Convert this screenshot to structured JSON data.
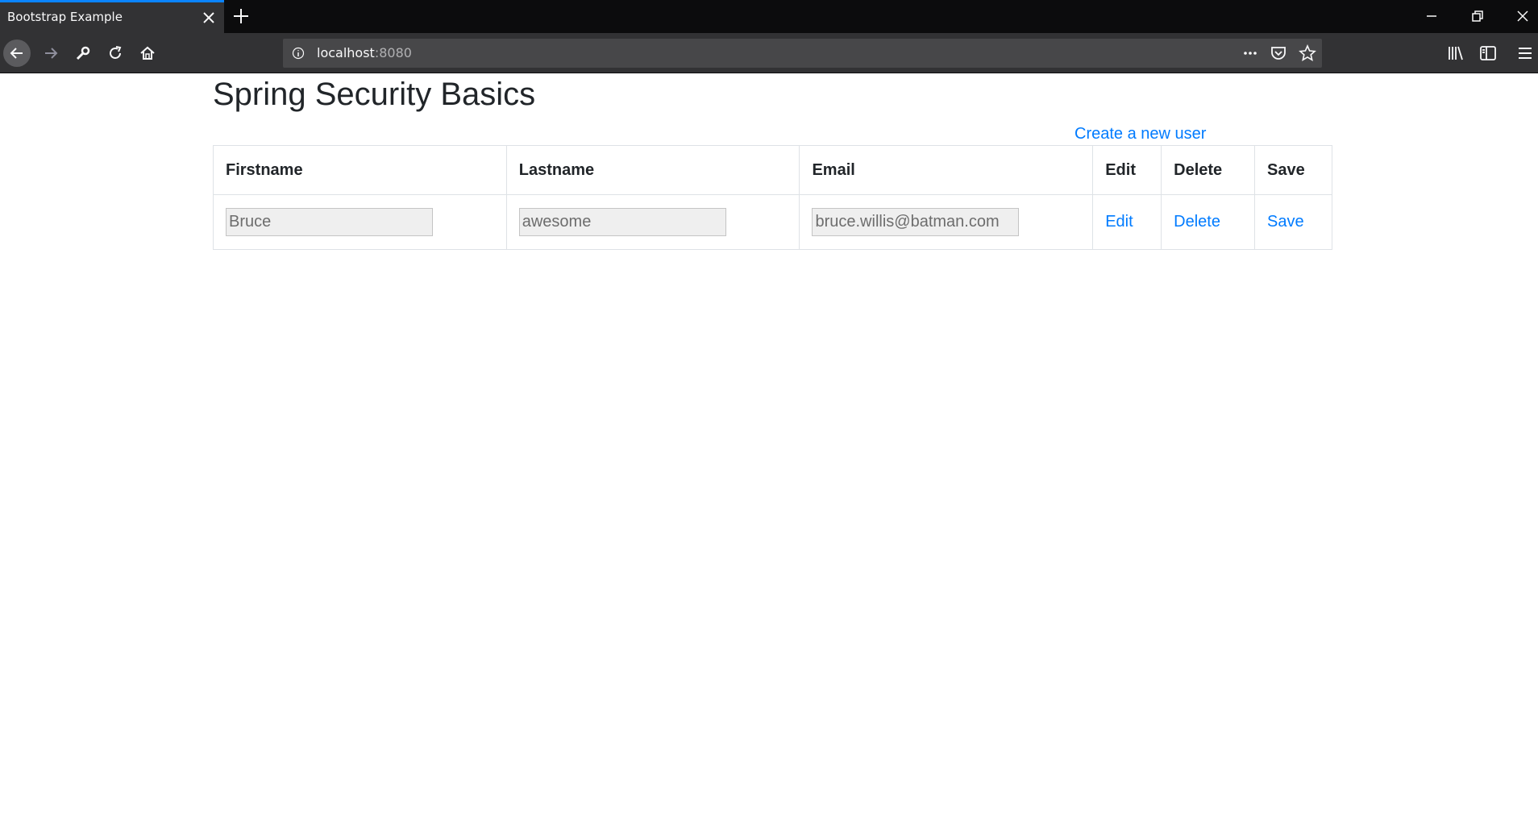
{
  "browser": {
    "tab_title": "Bootstrap Example",
    "url_host": "localhost",
    "url_port": ":8080"
  },
  "page": {
    "title": "Spring Security Basics",
    "create_link": "Create a new user"
  },
  "table": {
    "headers": [
      "Firstname",
      "Lastname",
      "Email",
      "Edit",
      "Delete",
      "Save"
    ],
    "rows": [
      {
        "firstname": "Bruce",
        "lastname": "awesome",
        "email": "bruce.willis@batman.com",
        "edit": "Edit",
        "delete": "Delete",
        "save": "Save"
      }
    ]
  },
  "colors": {
    "link": "#007bff",
    "chrome_dark": "#0c0c0d",
    "toolbar": "#323234",
    "tab_accent": "#0a84ff"
  },
  "icons": [
    "close-icon",
    "plus-icon",
    "minimize-icon",
    "restore-icon",
    "back-arrow-icon",
    "forward-arrow-icon",
    "wrench-icon",
    "reload-icon",
    "home-icon",
    "info-icon",
    "more-icon",
    "pocket-icon",
    "star-icon",
    "library-icon",
    "sidebar-icon",
    "hamburger-menu-icon"
  ]
}
